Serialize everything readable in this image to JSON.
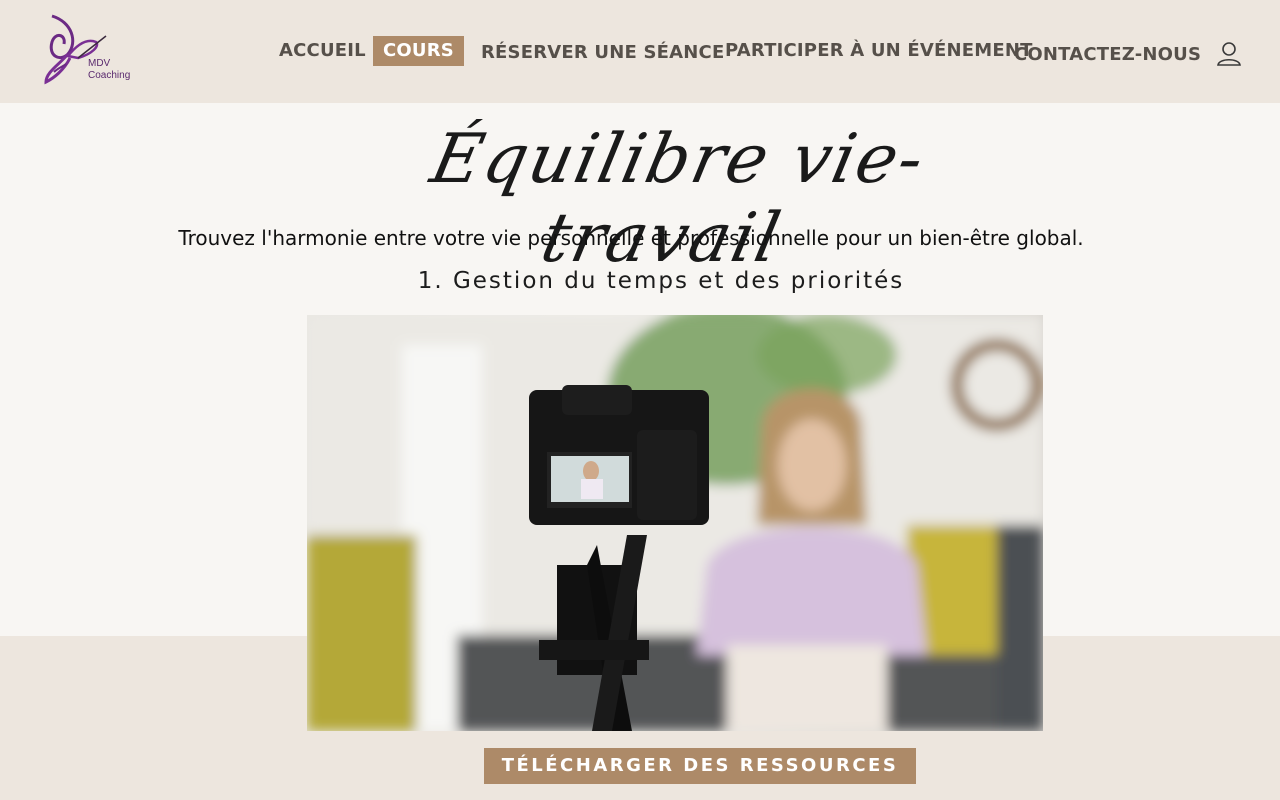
{
  "header": {
    "logo_text_line1": "MDV",
    "logo_text_line2": "Coaching",
    "nav": [
      {
        "label": "ACCUEIL",
        "active": false
      },
      {
        "label": "COURS",
        "active": true
      },
      {
        "label": "RÉSERVER UNE SÉANCE",
        "active": false
      },
      {
        "label": "PARTICIPER À UN ÉVÉNEMENT",
        "active": false
      },
      {
        "label": "CONTACTEZ-NOUS",
        "active": false
      }
    ],
    "user_icon": "user-icon"
  },
  "main": {
    "title": "Équilibre vie-travail",
    "subtitle": "Trouvez l'harmonie entre votre vie personnelle et professionnelle pour un bien-être global.",
    "section_title": "1. Gestion du temps et des priorités",
    "video_description_icon": "video-camera",
    "download_label": "TÉLÉCHARGER DES RESSOURCES"
  },
  "colors": {
    "header_bg": "#ede6de",
    "accent": "#ad8a68",
    "logo_purple": "#6b2a84",
    "page_bg": "#f8f6f3"
  }
}
